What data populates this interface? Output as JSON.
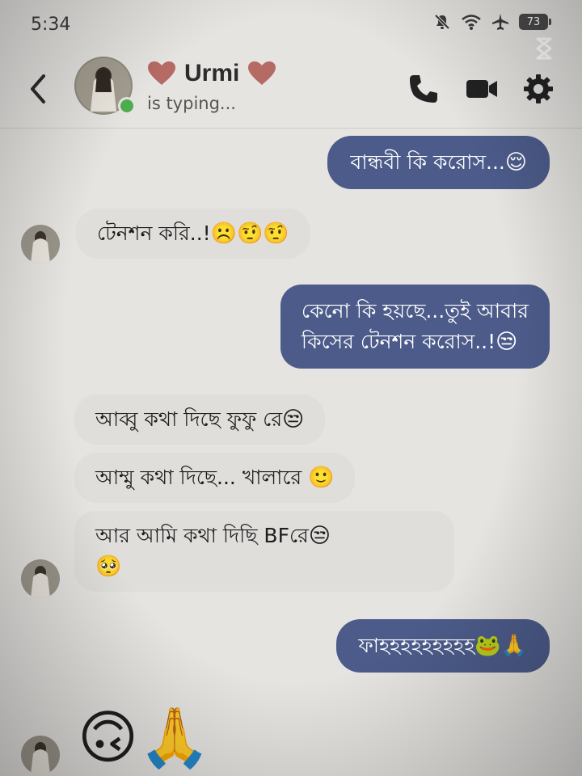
{
  "status_bar": {
    "time": "5:34",
    "battery": "73",
    "icons": [
      "mute-icon",
      "wifi-icon",
      "airplane-icon",
      "battery-icon",
      "capcut-icon"
    ]
  },
  "header": {
    "contact_name": "Urmi",
    "status": "is typing...",
    "icons": [
      "back-icon",
      "heart-icon",
      "phone-icon",
      "video-icon",
      "settings-icon"
    ]
  },
  "messages": [
    {
      "side": "out",
      "text": "বান্ধবী কি করোস...",
      "emoji": "😌"
    },
    {
      "side": "in",
      "text": "টেনশন করি..!",
      "emoji": "☹️🤨🤨"
    },
    {
      "side": "out",
      "text_lines": [
        "কেনো কি হয়ছে...তুই আবার",
        "কিসের টেনশন করোস..!"
      ],
      "emoji": "😒"
    },
    {
      "side": "in",
      "text": "আব্বু কথা দিছে ফুফু রে",
      "emoji": "😒"
    },
    {
      "side": "in",
      "text": "আম্মু কথা দিছে... খালারে ",
      "emoji": "🙂"
    },
    {
      "side": "in",
      "text": "আর আমি কথা দিছি BFরে",
      "emoji": "😒",
      "emoji_line2": "🥺"
    },
    {
      "side": "out",
      "text": "ফাহহহহহহহহহ",
      "emoji": "🐸🙏"
    },
    {
      "side": "in",
      "big_emoji": "🙃🙏"
    }
  ],
  "colors": {
    "background": "#e6e4e1",
    "outgoing_bubble": "#4c5b8a",
    "incoming_bubble": "#e0dedb",
    "online_dot": "#4fae4f",
    "heart": "#b56a63"
  }
}
